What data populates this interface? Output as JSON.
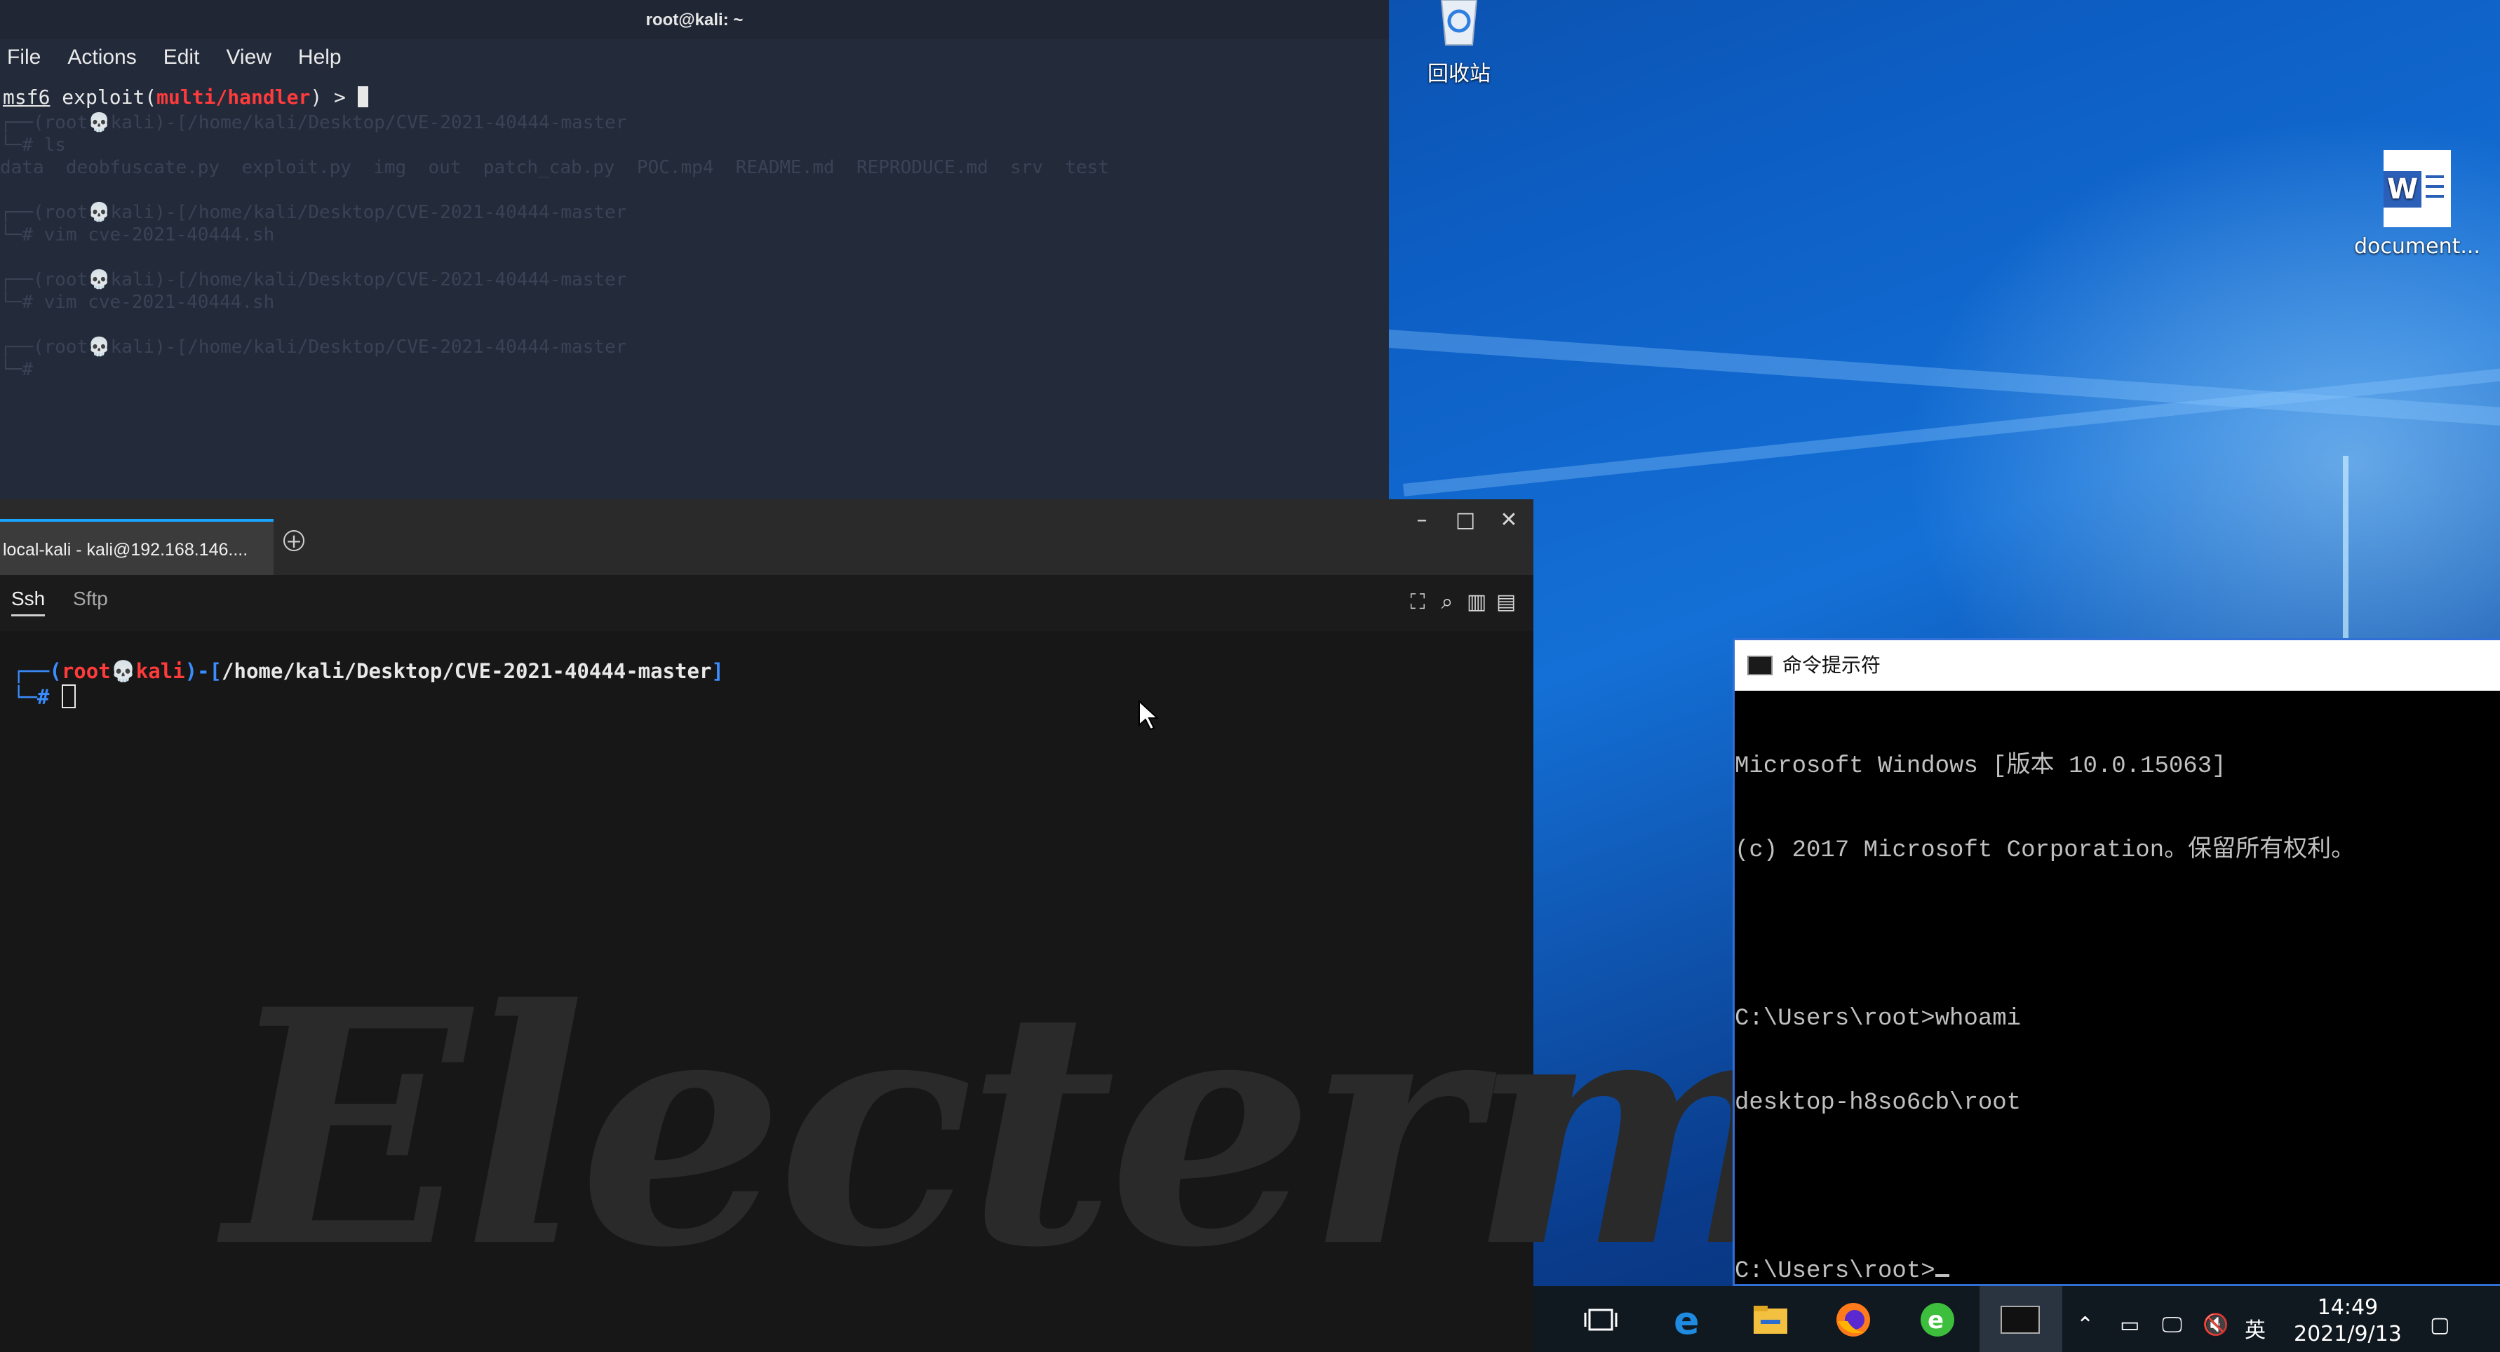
{
  "desktop": {
    "recycle_bin_label": "回收站",
    "document_label": "document...",
    "document_icon_letter": "W"
  },
  "kali_terminal": {
    "title": "root@kali: ~",
    "menu": [
      "File",
      "Actions",
      "Edit",
      "View",
      "Help"
    ],
    "prompt_msf": "msf6",
    "prompt_exploit": " exploit(",
    "prompt_handler": "multi/handler",
    "prompt_end": ") > ",
    "ghost_lines": [
      "┌──(root💀kali)-[/home/kali/Desktop/CVE-2021-40444-master",
      "└─# ls",
      "data  deobfuscate.py  exploit.py  img  out  patch_cab.py  POC.mp4  README.md  REPRODUCE.md  srv  test",
      "┌──(root💀kali)-[/home/kali/Desktop/CVE-2021-40444-master",
      "└─# vim cve-2021-40444.sh",
      "┌──(root💀kali)-[/home/kali/Desktop/CVE-2021-40444-master",
      "└─# vim cve-2021-40444.sh",
      "┌──(root💀kali)-[/home/kali/Desktop/CVE-2021-40444-master",
      "└─#"
    ]
  },
  "electerm": {
    "tab_label": "local-kali - kali@192.168.146....",
    "subtabs": [
      "Ssh",
      "Sftp"
    ],
    "active_subtab": "Ssh",
    "prompt_user": "root",
    "prompt_skull": "💀",
    "prompt_host": "kali",
    "prompt_path": "/home/kali/Desktop/CVE-2021-40444-master",
    "prompt_open": "┌──(",
    "prompt_mid": ")-[",
    "prompt_close": "]",
    "prompt_hash": "└─#",
    "watermark": "Electerm"
  },
  "cmd": {
    "title": "命令提示符",
    "lines": [
      "Microsoft Windows [版本 10.0.15063]",
      "(c) 2017 Microsoft Corporation。保留所有权利。",
      "",
      "C:\\Users\\root>whoami",
      "desktop-h8so6cb\\root",
      "",
      "C:\\Users\\root>"
    ]
  },
  "taskbar": {
    "time": "14:49",
    "date": "2021/9/13",
    "ime": "英"
  },
  "colors": {
    "kali_bg": "#232a3a",
    "handler_red": "#ff3b3b",
    "electerm_bg": "#171717",
    "prompt_blue": "#3a8dff",
    "prompt_red": "#ff3b3b",
    "accent_blue": "#1aa3ff"
  }
}
